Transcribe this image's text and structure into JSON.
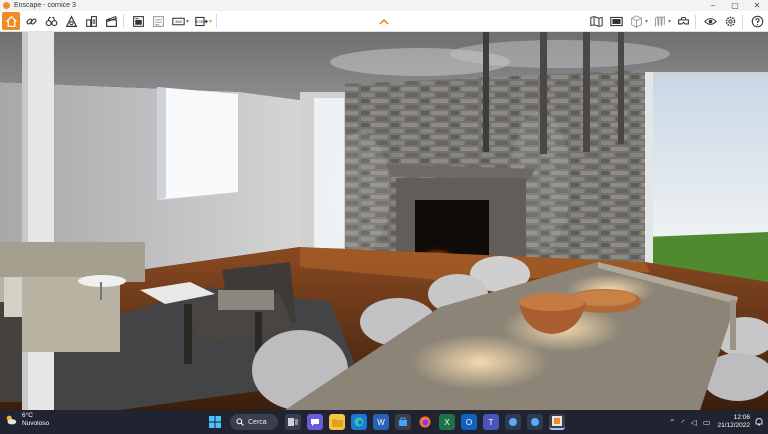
{
  "window": {
    "title": "Enscape - cornice 3"
  },
  "taskbar": {
    "weather": {
      "temp": "6°C",
      "condition": "Nuvoloso"
    },
    "search": {
      "label": "Cerca"
    },
    "clock": {
      "time": "12:06",
      "date": "21/12/2022"
    }
  },
  "colors": {
    "accent": "#f08a24",
    "taskbar": "#1f2430",
    "toolbar": "#ffffff"
  },
  "icons": {
    "toolbar_left": [
      "home-icon",
      "link-icon",
      "binoculars-icon",
      "visual-settings-icon",
      "buildings-icon",
      "clapperboard-icon",
      "screenshot-icon",
      "batch-render-icon",
      "panorama-icon",
      "export-icon"
    ],
    "toolbar_right": [
      "map-icon",
      "monitor-icon",
      "asset-library-icon",
      "material-icon",
      "vr-headset-icon",
      "eye-icon",
      "settings-icon",
      "help-icon"
    ]
  }
}
